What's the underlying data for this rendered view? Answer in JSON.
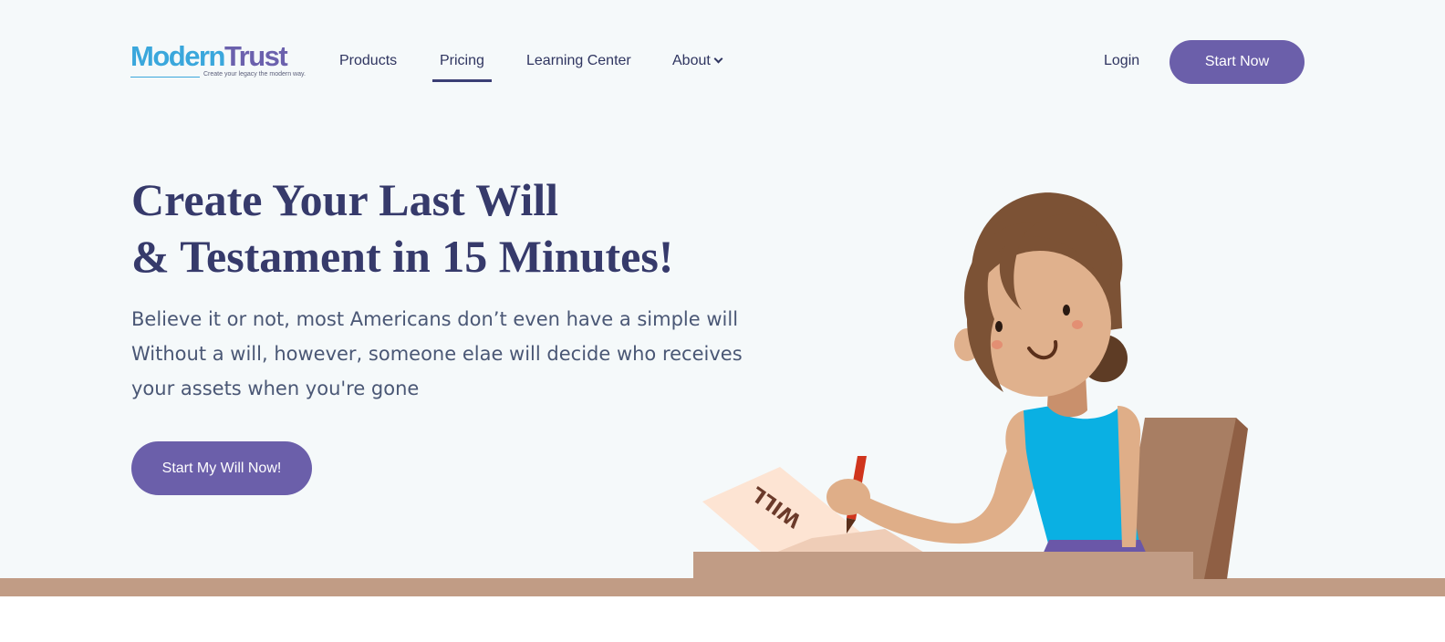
{
  "brand": {
    "name_part1": "Modern",
    "name_part2": "Trust",
    "tagline": "Create your legacy the modern way."
  },
  "nav": {
    "items": [
      {
        "label": "Products"
      },
      {
        "label": "Pricing",
        "active": true
      },
      {
        "label": "Learning Center"
      },
      {
        "label": "About"
      }
    ],
    "login_label": "Login",
    "start_label": "Start Now"
  },
  "hero": {
    "title_line1": "Create Your Last Will",
    "title_line2": "& Testament in 15 Minutes!",
    "subtitle_lines": [
      "Believe it or not, most Americans don’t even have a simple will",
      "Without a will, however, someone elae will decide who receives",
      "your assets when you're gone"
    ],
    "cta_label": "Start My Will Now!",
    "paper_text": "WILL"
  },
  "colors": {
    "accent": "#6b5faa",
    "heading": "#363a6b",
    "logo_blue": "#3aa7dc",
    "floor": "#c19c85",
    "background": "#f5f9fa"
  },
  "icons": {
    "about_dropdown": "chevron-down-icon"
  }
}
